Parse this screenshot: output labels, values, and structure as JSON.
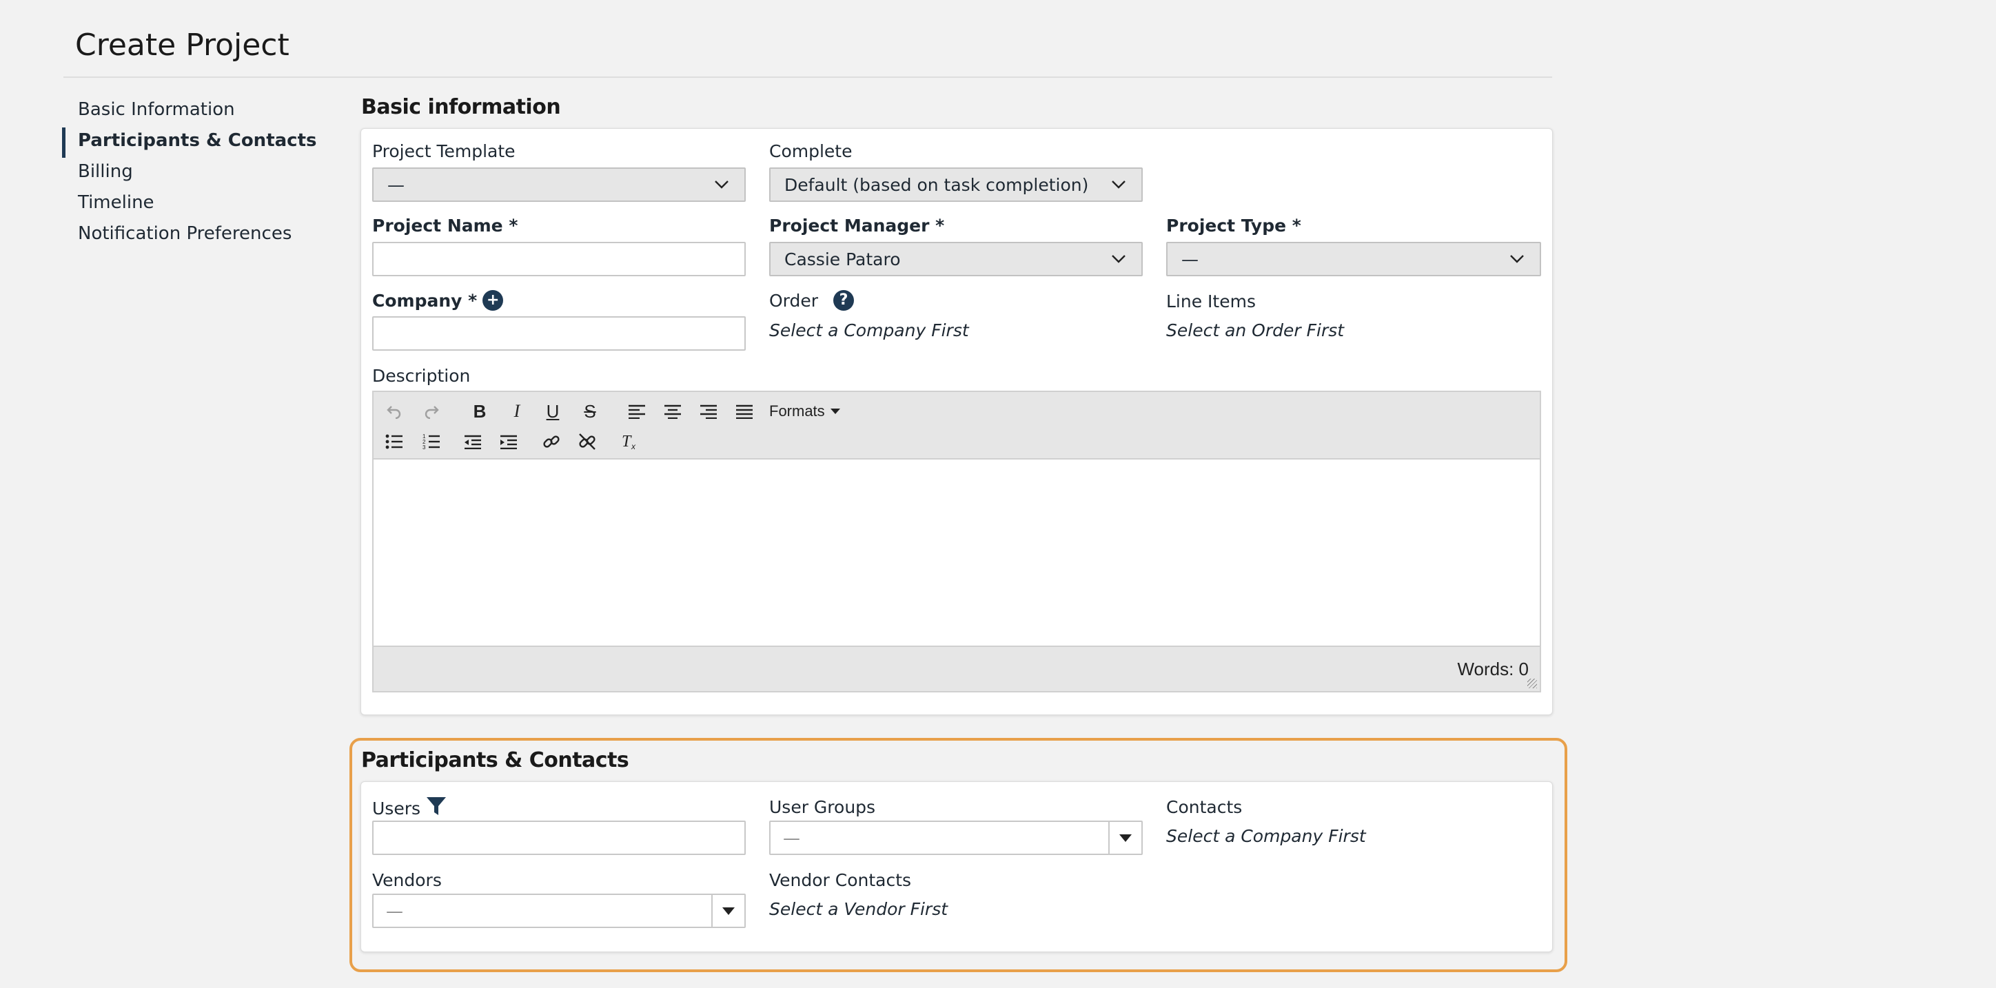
{
  "page": {
    "title": "Create Project"
  },
  "nav": {
    "items": [
      {
        "label": "Basic Information",
        "active": false
      },
      {
        "label": "Participants & Contacts",
        "active": true
      },
      {
        "label": "Billing",
        "active": false
      },
      {
        "label": "Timeline",
        "active": false
      },
      {
        "label": "Notification Preferences",
        "active": false
      }
    ]
  },
  "basic": {
    "section_title": "Basic information",
    "project_template": {
      "label": "Project Template",
      "value": "—"
    },
    "complete": {
      "label": "Complete",
      "value": "Default (based on task completion)"
    },
    "project_name": {
      "label": "Project Name *",
      "value": ""
    },
    "project_manager": {
      "label": "Project Manager *",
      "value": "Cassie Pataro"
    },
    "project_type": {
      "label": "Project Type *",
      "value": "—"
    },
    "company": {
      "label": "Company *",
      "value": ""
    },
    "order": {
      "label": "Order",
      "hint": "Select a Company First"
    },
    "line_items": {
      "label": "Line Items",
      "hint": "Select an Order First"
    },
    "description": {
      "label": "Description",
      "formats_label": "Formats",
      "word_count": "Words: 0"
    }
  },
  "participants": {
    "section_title": "Participants & Contacts",
    "users": {
      "label": "Users",
      "value": ""
    },
    "user_groups": {
      "label": "User Groups",
      "value": "—"
    },
    "contacts": {
      "label": "Contacts",
      "hint": "Select a Company First"
    },
    "vendors": {
      "label": "Vendors",
      "value": "—"
    },
    "vendor_contacts": {
      "label": "Vendor Contacts",
      "hint": "Select a Vendor First"
    }
  },
  "colors": {
    "accent": "#1f3a54",
    "highlight": "#e8a04a",
    "background": "#f2f2f2"
  }
}
